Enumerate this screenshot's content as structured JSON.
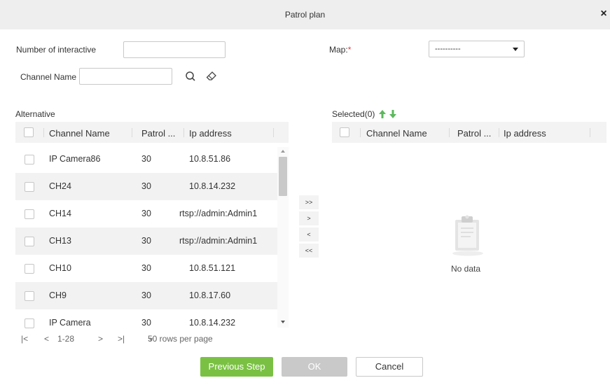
{
  "dialog": {
    "title": "Patrol plan",
    "close_glyph": "×"
  },
  "form": {
    "interactive_label": "Number of interactive",
    "interactive_value": "",
    "map_label": "Map:",
    "map_required": "*",
    "map_value": "----------",
    "channel_label": "Channel Name",
    "channel_value": ""
  },
  "alternative": {
    "label": "Alternative",
    "columns": [
      "Channel Name",
      "Patrol ...",
      "Ip address"
    ],
    "rows": [
      {
        "name": "IP Camera86",
        "patrol": "30",
        "ip": "10.8.51.86"
      },
      {
        "name": "CH24",
        "patrol": "30",
        "ip": "10.8.14.232"
      },
      {
        "name": "CH14",
        "patrol": "30",
        "ip": "rtsp://admin:Admin1"
      },
      {
        "name": "CH13",
        "patrol": "30",
        "ip": "rtsp://admin:Admin1"
      },
      {
        "name": "CH10",
        "patrol": "30",
        "ip": "10.8.51.121"
      },
      {
        "name": "CH9",
        "patrol": "30",
        "ip": "10.8.17.60"
      },
      {
        "name": "IP Camera",
        "patrol": "30",
        "ip": "10.8.14.232"
      }
    ],
    "pager": {
      "first": "|<",
      "prev": "<",
      "range": "1-28",
      "next": ">",
      "last": ">|",
      "rows_per_page": "50 rows per page"
    }
  },
  "transfer": {
    "all_right": ">>",
    "right": ">",
    "left": "<",
    "all_left": "<<"
  },
  "selected": {
    "label": "Selected(0)",
    "columns": [
      "Channel Name",
      "Patrol ...",
      "Ip address"
    ],
    "empty_text": "No data"
  },
  "buttons": {
    "previous": "Previous Step",
    "ok": "OK",
    "cancel": "Cancel"
  },
  "colors": {
    "accent_green": "#7ac143",
    "disabled": "#c9c9c9",
    "arrow_green": "#5cb85c",
    "required_red": "#e03b3b"
  }
}
